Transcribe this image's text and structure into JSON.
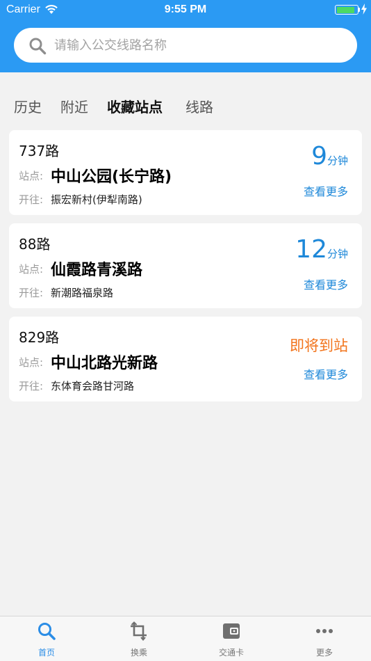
{
  "status_bar": {
    "carrier": "Carrier",
    "time": "9:55 PM",
    "battery_level": 0.9
  },
  "search": {
    "placeholder": "请输入公交线路名称",
    "value": ""
  },
  "tabs": [
    {
      "label": "历史",
      "active": false
    },
    {
      "label": "附近",
      "active": false
    },
    {
      "label": "收藏站点",
      "active": true
    },
    {
      "label": "线路",
      "active": false
    }
  ],
  "labels": {
    "stop": "站点:",
    "toward": "开往:",
    "more": "查看更多",
    "minutes_unit": "分钟"
  },
  "cards": [
    {
      "route": "737路",
      "stop": "中山公园(长宁路)",
      "direction": "振宏新村(伊犁南路)",
      "eta": "9",
      "status": ""
    },
    {
      "route": "88路",
      "stop": "仙霞路青溪路",
      "direction": "新潮路福泉路",
      "eta": "12",
      "status": ""
    },
    {
      "route": "829路",
      "stop": "中山北路光新路",
      "direction": "东体育会路甘河路",
      "eta": "",
      "status": "即将到站"
    }
  ],
  "tabbar": [
    {
      "label": "首页",
      "icon": "search-icon",
      "active": true
    },
    {
      "label": "换乘",
      "icon": "transfer-icon",
      "active": false
    },
    {
      "label": "交通卡",
      "icon": "wallet-icon",
      "active": false
    },
    {
      "label": "更多",
      "icon": "more-dots-icon",
      "active": false
    }
  ],
  "colors": {
    "primary": "#2b9af3",
    "eta": "#1e88d9",
    "arriving": "#f2741c",
    "background": "#f2f2f2"
  }
}
